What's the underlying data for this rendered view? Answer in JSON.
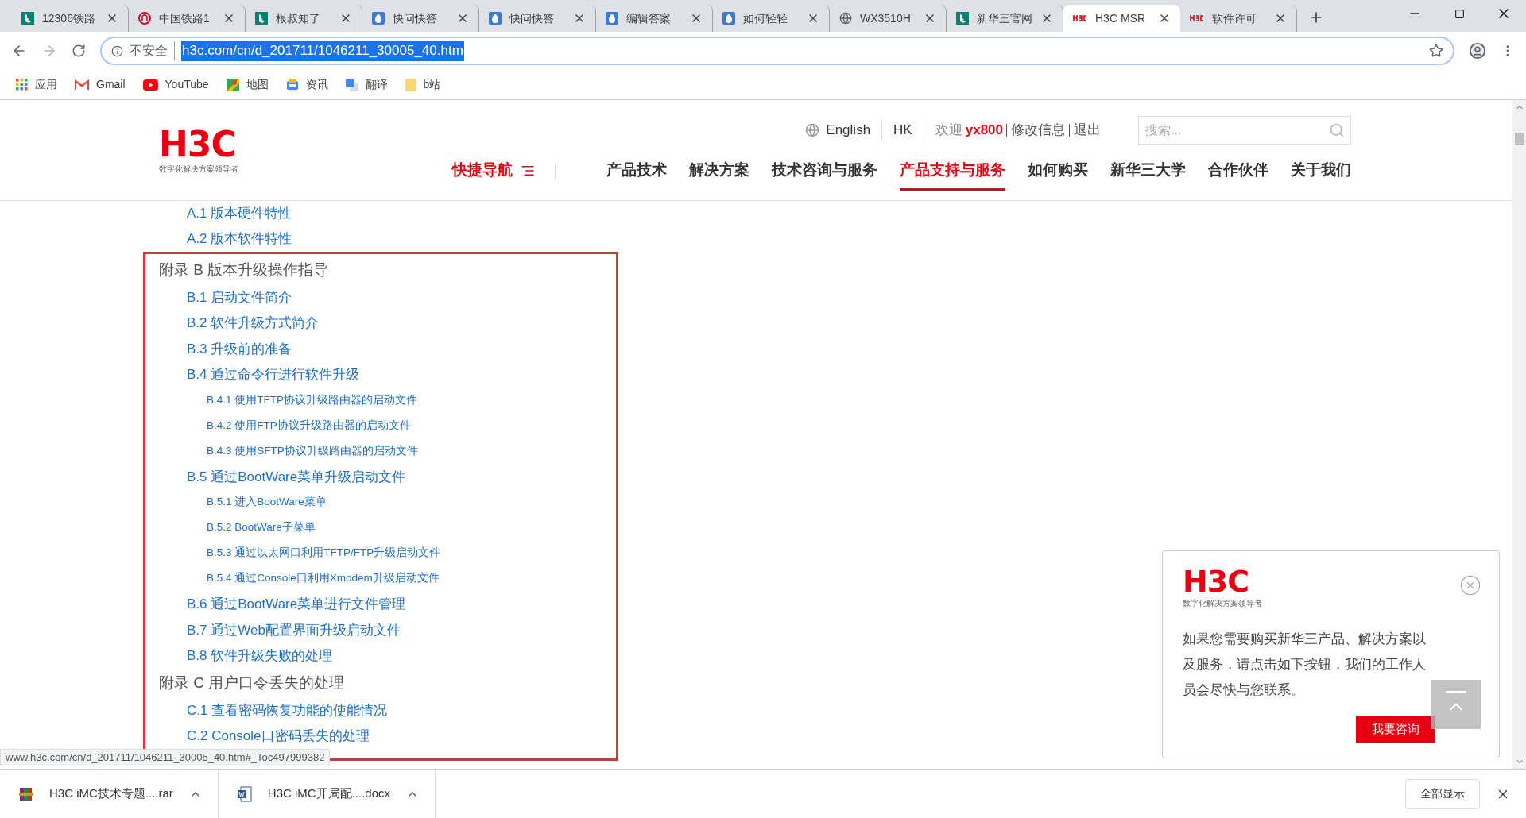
{
  "browser": {
    "tabs": [
      {
        "title": "12306铁路",
        "kind": "bing",
        "selected": false
      },
      {
        "title": "中国铁路1",
        "kind": "railway",
        "selected": false
      },
      {
        "title": "根叔知了",
        "kind": "bing",
        "selected": false
      },
      {
        "title": "快问快答",
        "kind": "drop",
        "selected": false
      },
      {
        "title": "快问快答",
        "kind": "drop",
        "selected": false
      },
      {
        "title": "编辑答案",
        "kind": "drop",
        "selected": false
      },
      {
        "title": "如何轻轻",
        "kind": "drop",
        "selected": false
      },
      {
        "title": "WX3510H",
        "kind": "globe",
        "selected": false
      },
      {
        "title": "新华三官网",
        "kind": "bing",
        "selected": false
      },
      {
        "title": "H3C MSR",
        "kind": "h3c",
        "selected": true
      },
      {
        "title": "软件许可",
        "kind": "h3c",
        "selected": false
      }
    ],
    "address": {
      "security": "不安全",
      "url": "h3c.com/cn/d_201711/1046211_30005_40.htm",
      "url_selected": true
    },
    "bookmarks": [
      {
        "label": "应用",
        "kind": "apps"
      },
      {
        "label": "Gmail",
        "kind": "gmail"
      },
      {
        "label": "YouTube",
        "kind": "youtube"
      },
      {
        "label": "地图",
        "kind": "maps"
      },
      {
        "label": "资讯",
        "kind": "news"
      },
      {
        "label": "翻译",
        "kind": "translate"
      },
      {
        "label": "b站",
        "kind": "folder"
      }
    ]
  },
  "header": {
    "logo": {
      "text": "H3C",
      "tagline": "数字化解决方案领导者"
    },
    "language": "English",
    "region": "HK",
    "welcome": "欢迎",
    "user": "yx800",
    "links": [
      "修改信息",
      "退出"
    ],
    "search": {
      "placeholder": "搜索..."
    },
    "nav": [
      {
        "label": "快捷导航",
        "kind": "menu",
        "selected": false
      },
      {
        "label": "产品技术",
        "kind": "link",
        "selected": false
      },
      {
        "label": "解决方案",
        "kind": "link",
        "selected": false
      },
      {
        "label": "技术咨询与服务",
        "kind": "link",
        "selected": false
      },
      {
        "label": "产品支持与服务",
        "kind": "link",
        "selected": true
      },
      {
        "label": "如何购买",
        "kind": "link",
        "selected": false
      },
      {
        "label": "新华三大学",
        "kind": "link",
        "selected": false
      },
      {
        "label": "合作伙伴",
        "kind": "link",
        "selected": false
      },
      {
        "label": "关于我们",
        "kind": "link",
        "selected": false
      }
    ]
  },
  "toc": {
    "items_before": [
      {
        "label": "A.1 版本硬件特性"
      },
      {
        "label": "A.2 版本软件特性"
      }
    ],
    "highlighted": [
      {
        "label": "附录 B 版本升级操作指导",
        "children": [
          {
            "label": "B.1 启动文件简介"
          },
          {
            "label": "B.2 软件升级方式简介"
          },
          {
            "label": "B.3 升级前的准备"
          },
          {
            "label": "B.4 通过命令行进行软件升级",
            "children": [
              {
                "label": "B.4.1 使用TFTP协议升级路由器的启动文件"
              },
              {
                "label": "B.4.2 使用FTP协议升级路由器的启动文件"
              },
              {
                "label": "B.4.3 使用SFTP协议升级路由器的启动文件"
              }
            ]
          },
          {
            "label": "B.5 通过BootWare菜单升级启动文件",
            "children": [
              {
                "label": "B.5.1 进入BootWare菜单"
              },
              {
                "label": "B.5.2 BootWare子菜单"
              },
              {
                "label": "B.5.3 通过以太网口利用TFTP/FTP升级启动文件"
              },
              {
                "label": "B.5.4 通过Console口利用Xmodem升级启动文件"
              }
            ]
          },
          {
            "label": "B.6 通过BootWare菜单进行文件管理"
          },
          {
            "label": "B.7 通过Web配置界面升级启动文件"
          },
          {
            "label": "B.8 软件升级失败的处理"
          }
        ]
      },
      {
        "label": "附录 C 用户口令丢失的处理",
        "children": [
          {
            "label": "C.1 查看密码恢复功能的使能情况"
          },
          {
            "label": "C.2 Console口密码丢失的处理"
          }
        ]
      }
    ]
  },
  "popup": {
    "logo": {
      "text": "H3C",
      "tagline": "数字化解决方案领导者"
    },
    "message": "如果您需要购买新华三产品、解决方案以及服务，请点击如下按钮，我们的工作人员会尽快与您联系。",
    "button": "我要咨询"
  },
  "status_url": "www.h3c.com/cn/d_201711/1046211_30005_40.htm#_Toc497999382",
  "downloads": {
    "items": [
      {
        "name": "H3C iMC技术专题....rar",
        "kind": "archive"
      },
      {
        "name": "H3C iMC开局配....docx",
        "kind": "word"
      }
    ],
    "show_all": "全部显示"
  }
}
